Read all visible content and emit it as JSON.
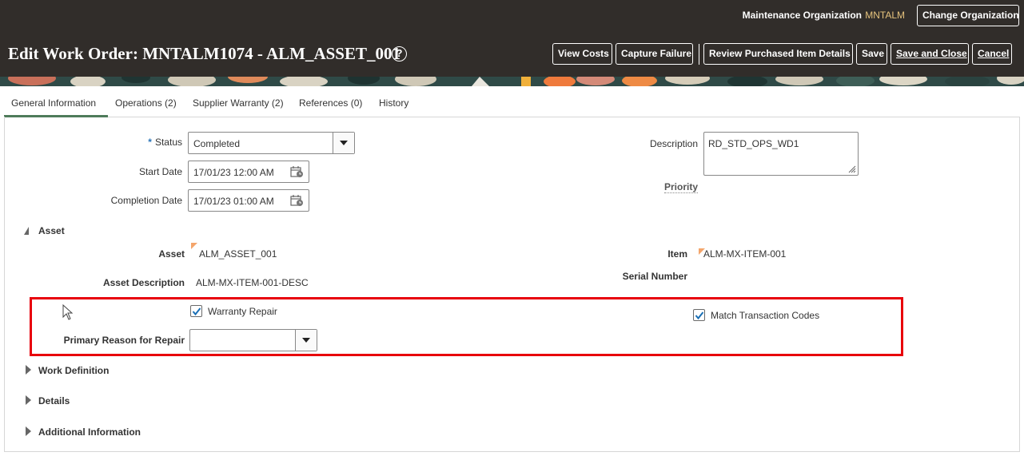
{
  "header": {
    "org_label": "Maintenance Organization",
    "org_value": "MNTALM",
    "change_org_label": "Change Organization",
    "title": "Edit Work Order: MNTALM1074 - ALM_ASSET_001",
    "help_icon": "?",
    "buttons": {
      "view_costs": "View Costs",
      "capture_failure": "Capture Failure",
      "review_purchased": "Review Purchased Item Details",
      "save": "Save",
      "save_and_close": "Save and Close",
      "cancel": "Cancel"
    }
  },
  "tabs": [
    {
      "label": "General Information",
      "active": true
    },
    {
      "label": "Operations (2)"
    },
    {
      "label": "Supplier Warranty (2)"
    },
    {
      "label": "References (0)"
    },
    {
      "label": "History"
    }
  ],
  "form": {
    "status_required": "*",
    "status_label": "Status",
    "status_value": "Completed",
    "start_date_label": "Start Date",
    "start_date_value": "17/01/23 12:00 AM",
    "completion_date_label": "Completion Date",
    "completion_date_value": "17/01/23 01:00 AM",
    "description_label": "Description",
    "description_value": "RD_STD_OPS_WD1",
    "priority_label": "Priority"
  },
  "asset_section": {
    "title": "Asset",
    "asset_label": "Asset",
    "asset_value": "ALM_ASSET_001",
    "asset_description_label": "Asset Description",
    "asset_description_value": "ALM-MX-ITEM-001-DESC",
    "item_label": "Item",
    "item_value": "ALM-MX-ITEM-001",
    "serial_number_label": "Serial Number",
    "warranty_repair_label": "Warranty Repair",
    "warranty_repair_checked": true,
    "match_codes_label": "Match Transaction Codes",
    "match_codes_checked": true,
    "primary_reason_label": "Primary Reason for Repair",
    "primary_reason_value": ""
  },
  "collapsed_sections": {
    "work_definition": "Work Definition",
    "details": "Details",
    "additional_information": "Additional Information"
  },
  "colors": {
    "header_bg": "#312d2a",
    "org_value": "#e5c27d",
    "tab_active": "#4e7b5a",
    "highlight": "#e8000b",
    "checkbox_check": "#1a6fb5"
  }
}
